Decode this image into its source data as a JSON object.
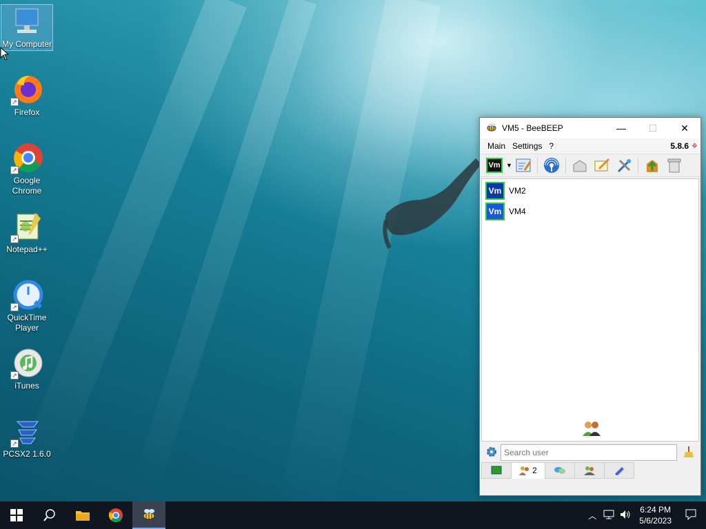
{
  "desktop": {
    "icons": [
      {
        "label": "My Computer"
      },
      {
        "label": "Firefox"
      },
      {
        "label": "Google Chrome"
      },
      {
        "label": "Notepad++"
      },
      {
        "label": "QuickTime Player"
      },
      {
        "label": "iTunes"
      },
      {
        "label": "PCSX2 1.6.0"
      }
    ]
  },
  "window": {
    "title": "VM5 - BeeBEEP",
    "menu": {
      "main": "Main",
      "settings": "Settings",
      "help": "?"
    },
    "version": "5.8.6",
    "my_avatar": "Vm",
    "users": [
      {
        "avatar": "Vm",
        "name": "VM2"
      },
      {
        "avatar": "Vm",
        "name": "VM4"
      }
    ],
    "search_placeholder": "Search user",
    "tabs": {
      "users_count": "2"
    }
  },
  "taskbar": {
    "time": "6:24 PM",
    "date": "5/6/2023"
  },
  "colors": {
    "online_border": "#2ecc40",
    "avatar_bg": "#0a3aa8",
    "taskbar_bg": "#10161f"
  }
}
